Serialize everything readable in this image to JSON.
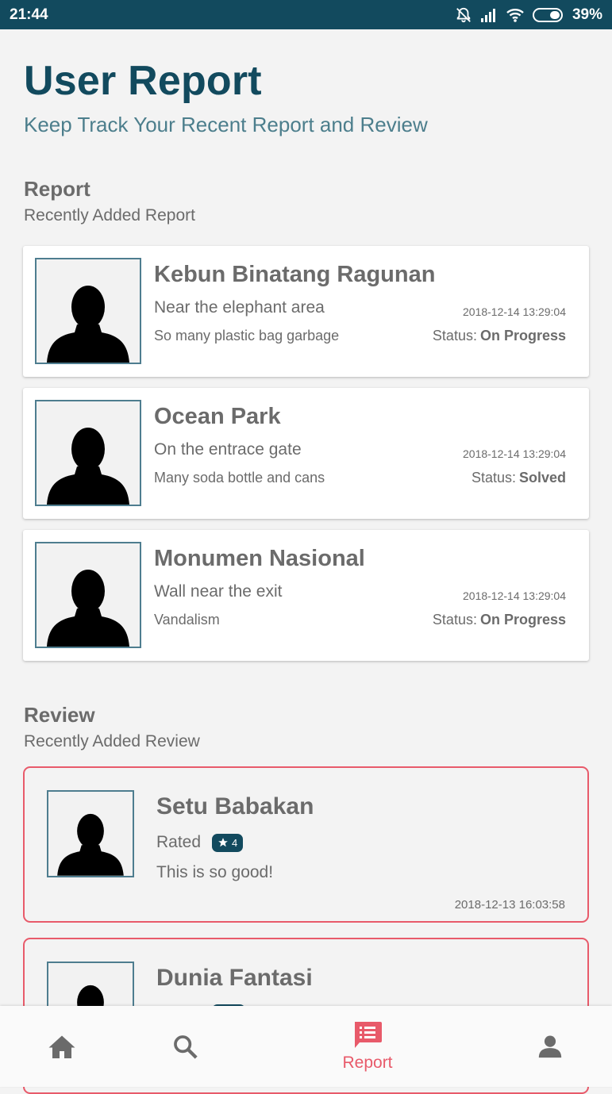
{
  "status_bar": {
    "time": "21:44",
    "battery": "39%"
  },
  "header": {
    "title": "User Report",
    "subtitle": "Keep Track Your Recent Report and Review"
  },
  "report_section": {
    "title": "Report",
    "subtitle": "Recently Added Report",
    "status_prefix": "Status:",
    "items": [
      {
        "name": "Kebun Binatang Ragunan",
        "location": "Near the elephant area",
        "description": "So many plastic bag garbage",
        "date": "2018-12-14 13:29:04",
        "status": "On Progress"
      },
      {
        "name": "Ocean Park",
        "location": "On the entrace gate",
        "description": "Many soda bottle and cans",
        "date": "2018-12-14 13:29:04",
        "status": "Solved"
      },
      {
        "name": "Monumen Nasional",
        "location": "Wall near the exit",
        "description": "Vandalism",
        "date": "2018-12-14 13:29:04",
        "status": "On Progress"
      }
    ]
  },
  "review_section": {
    "title": "Review",
    "subtitle": "Recently Added Review",
    "rated_label": "Rated",
    "items": [
      {
        "name": "Setu Babakan",
        "rating": "4",
        "comment": "This is so good!",
        "date": "2018-12-13 16:03:58"
      },
      {
        "name": "Dunia Fantasi"
      }
    ]
  },
  "bottom_nav": {
    "items": [
      {
        "icon": "home-icon"
      },
      {
        "icon": "search-icon"
      },
      {
        "icon": "report-icon",
        "label": "Report",
        "active": true
      },
      {
        "icon": "profile-icon"
      }
    ]
  },
  "colors": {
    "primary": "#124a5e",
    "accent": "#e85a6a",
    "text": "#6b6b6b",
    "background": "#f3f3f3"
  }
}
